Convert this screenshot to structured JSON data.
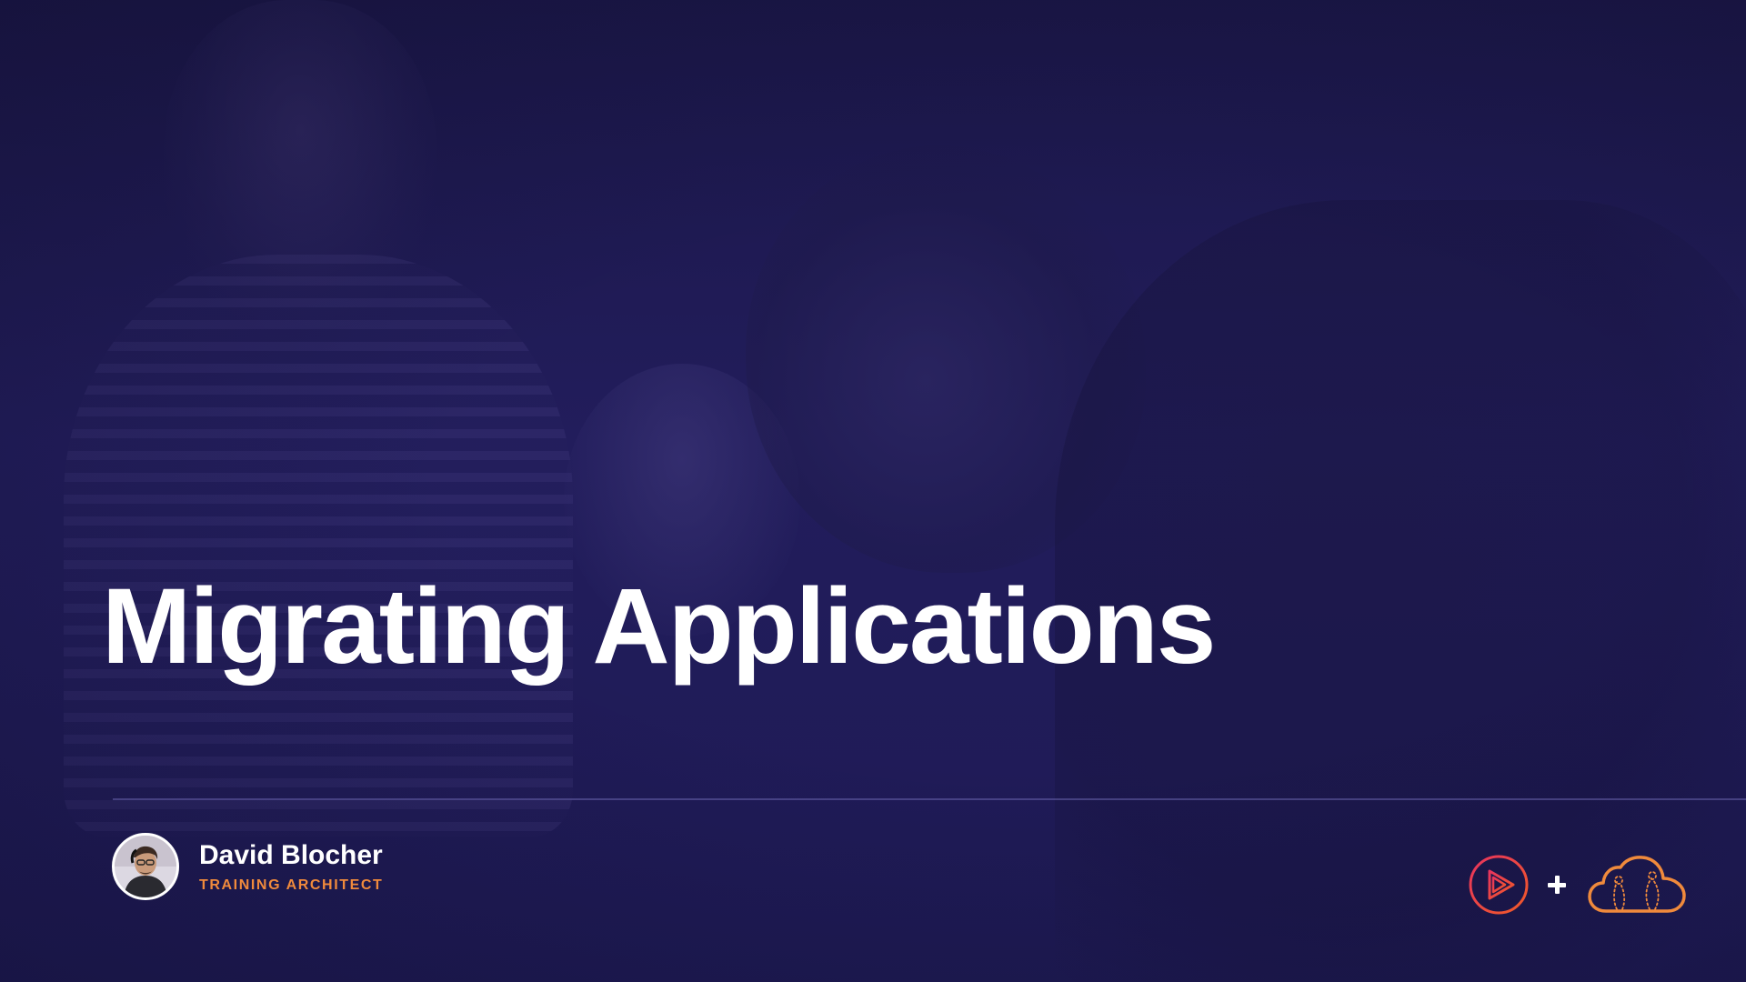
{
  "slide": {
    "title": "Migrating Applications"
  },
  "presenter": {
    "name": "David Blocher",
    "role": "TRAINING ARCHITECT",
    "avatar_icon": "person-photo"
  },
  "logos": {
    "left_logo_icon": "pluralsight-play-icon",
    "separator_icon": "plus-icon",
    "right_logo_icon": "acloudguru-cloud-icon"
  },
  "colors": {
    "background": "#1d1950",
    "title_text": "#ffffff",
    "role_accent": "#f08a3c",
    "pluralsight_gradient_start": "#e8345e",
    "pluralsight_gradient_end": "#f05a28",
    "cloud_logo": "#f08a3c"
  }
}
